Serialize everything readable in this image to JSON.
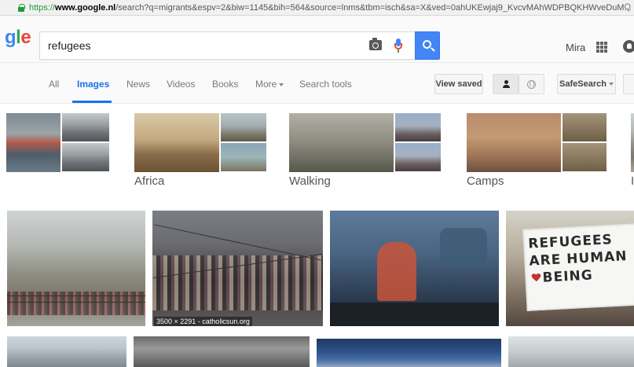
{
  "browser": {
    "url_scheme": "https://",
    "url_host": "www.google.nl",
    "url_rest": "/search?q=migrants&espv=2&biw=1145&bih=564&source=lnms&tbm=isch&sa=X&ved=0ahUKEwjaj9_KvcvMAhWDPBQKHWveDuM...",
    "zoom_glyph": "Q"
  },
  "header": {
    "logo": {
      "g": "g",
      "l": "l",
      "e": "e"
    },
    "query": "refugees",
    "user_name": "Mira"
  },
  "tabs": {
    "items": [
      "All",
      "Images",
      "News",
      "Videos",
      "Books",
      "More",
      "Search tools"
    ],
    "active": "Images",
    "view_saved": "View saved",
    "safesearch": "SafeSearch"
  },
  "related": [
    {
      "label": ""
    },
    {
      "label": "Africa"
    },
    {
      "label": "Walking"
    },
    {
      "label": "Camps"
    },
    {
      "label": "I"
    }
  ],
  "results": {
    "captions": [
      "3500 × 2291 - catholicsun.org"
    ],
    "sign_text": [
      "REFUGEES",
      "ARE HUMAN",
      "BEING"
    ]
  },
  "colors": {
    "google_blue": "#4285f4",
    "google_red": "#ea4335",
    "google_green": "#34a853",
    "active_tab": "#1a73e8"
  }
}
